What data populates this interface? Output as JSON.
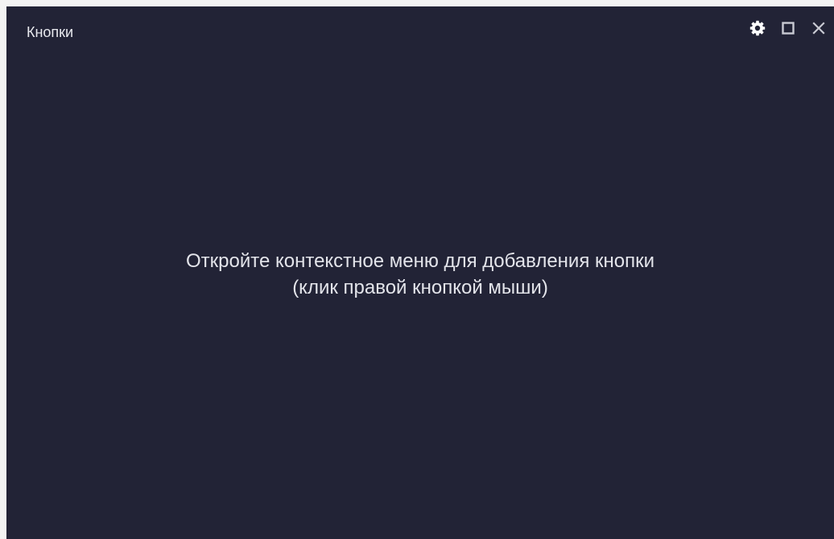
{
  "window": {
    "title": "Кнопки",
    "background_color": "#222336",
    "controls": [
      {
        "name": "settings",
        "icon": "gear-icon"
      },
      {
        "name": "maximize",
        "icon": "square-icon"
      },
      {
        "name": "close",
        "icon": "close-icon"
      }
    ]
  },
  "main": {
    "hint_line1": "Откройте контекстное меню для добавления кнопки",
    "hint_line2": "(клик правой кнопкой мыши)"
  }
}
